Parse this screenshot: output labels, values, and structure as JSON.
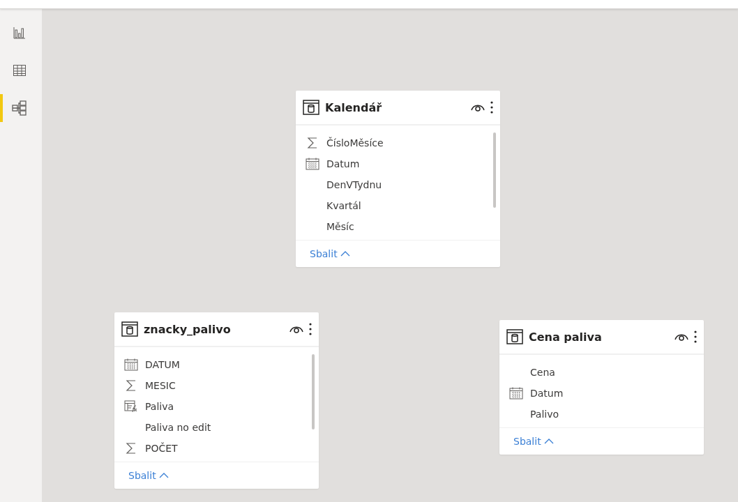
{
  "sidebar": {
    "items": [
      {
        "kind": "report",
        "selected": false
      },
      {
        "kind": "data",
        "selected": false
      },
      {
        "kind": "model",
        "selected": true
      }
    ]
  },
  "tables": [
    {
      "title": "Kalendář",
      "scrollable": true,
      "collapse_label": "Sbalit",
      "fields": [
        {
          "name": "ČísloMěsíce",
          "kind": "sum"
        },
        {
          "name": "Datum",
          "kind": "date"
        },
        {
          "name": "DenVTydnu",
          "kind": "plain"
        },
        {
          "name": "Kvartál",
          "kind": "plain"
        },
        {
          "name": "Měsíc",
          "kind": "plain"
        }
      ]
    },
    {
      "title": "znacky_palivo",
      "scrollable": true,
      "collapse_label": "Sbalit",
      "fields": [
        {
          "name": "DATUM",
          "kind": "date"
        },
        {
          "name": "MESIC",
          "kind": "sum"
        },
        {
          "name": "Paliva",
          "kind": "calc"
        },
        {
          "name": "Paliva no edit",
          "kind": "plain"
        },
        {
          "name": "POČET",
          "kind": "sum"
        }
      ]
    },
    {
      "title": "Cena paliva",
      "scrollable": false,
      "collapse_label": "Sbalit",
      "fields": [
        {
          "name": "Cena",
          "kind": "plain"
        },
        {
          "name": "Datum",
          "kind": "date"
        },
        {
          "name": "Palivo",
          "kind": "plain"
        }
      ]
    }
  ]
}
